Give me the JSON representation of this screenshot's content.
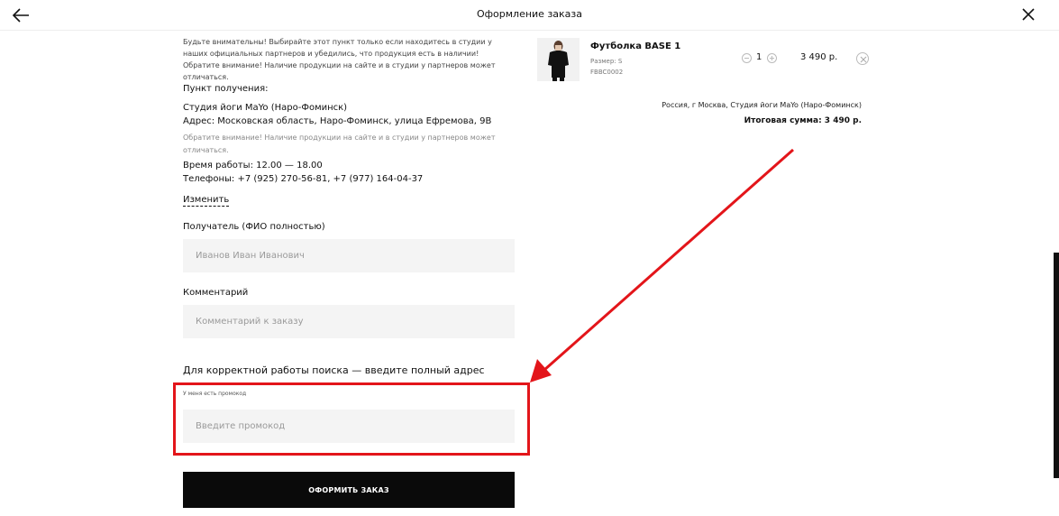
{
  "header": {
    "title": "Оформление заказа",
    "back_icon": "arrow-left-icon",
    "close_icon": "close-icon"
  },
  "pickup": {
    "notice": "Будьте внимательны! Выбирайте этот пункт только если находитесь в студии у наших официальных партнеров и убедились, что продукция есть в наличии! Обратите внимание! Наличие продукции на сайте и в студии у партнеров может отличаться.",
    "label": "Пункт получения:",
    "studio_name": "Студия йоги MaYo (Наро-Фоминск)",
    "address": "Адрес: Московская область, Наро-Фоминск, улица Ефремова, 9В",
    "studio_notice": "Обратите внимание! Наличие продукции на сайте и в студии у партнеров может отличаться.",
    "hours": "Время работы: 12.00 — 18.00",
    "phones": "Телефоны: +7 (925) 270-56-81, +7 (977) 164-04-37",
    "change_link": "Изменить"
  },
  "form": {
    "recipient_label": "Получатель (ФИО полностью)",
    "recipient_placeholder": "Иванов Иван Иванович",
    "recipient_value": "",
    "comment_label": "Комментарий",
    "comment_placeholder": "Комментарий к заказу",
    "comment_value": "",
    "search_hint": "Для корректной работы поиска — введите полный адрес",
    "promo_label": "У меня есть промокод",
    "promo_placeholder": "Введите промокод",
    "promo_value": "",
    "submit_label": "ОФОРМИТЬ ЗАКАЗ"
  },
  "cart": {
    "items": [
      {
        "name": "Футболка BASE 1",
        "size": "Размер: S",
        "sku": "FBBC0002",
        "quantity": "1",
        "price": "3 490 р."
      }
    ],
    "delivery_point": "Россия, г Москва, Студия йоги MaYo (Наро-Фоминск)",
    "total": "Итоговая сумма: 3 490 р."
  },
  "colors": {
    "accent_red": "#e3151a",
    "button_black": "#0a0a0a",
    "input_bg": "#f4f4f4"
  }
}
